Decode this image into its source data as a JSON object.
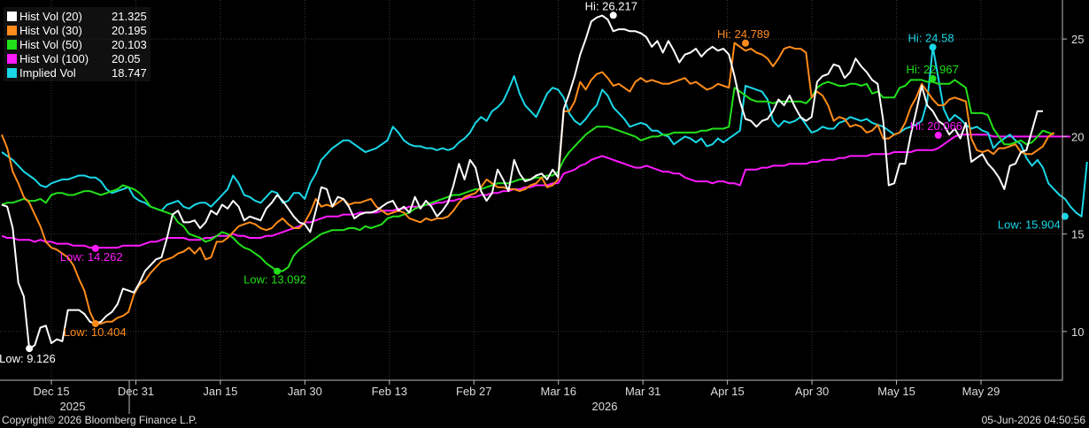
{
  "legend": [
    {
      "name": "Hist Vol (20)",
      "value": "21.325",
      "color": "#ffffff"
    },
    {
      "name": "Hist Vol (30)",
      "value": "20.195",
      "color": "#ff8c1a"
    },
    {
      "name": "Hist Vol (50)",
      "value": "20.103",
      "color": "#22e01a"
    },
    {
      "name": "Hist Vol (100)",
      "value": "20.05",
      "color": "#ff1aff"
    },
    {
      "name": "Implied Vol",
      "value": "18.747",
      "color": "#1ad8e8"
    }
  ],
  "footer": {
    "copyright": "Copyright© 2026 Bloomberg Finance L.P.",
    "timestamp": "05-Jun-2026 04:50:56"
  },
  "chart_data": {
    "type": "line",
    "x_axis": {
      "ticks": [
        "Dec 15",
        "Dec 31",
        "Jan 15",
        "Jan 30",
        "Feb 13",
        "Feb 27",
        "Mar 16",
        "Mar 31",
        "Apr 15",
        "Apr 30",
        "May 15",
        "May 29"
      ],
      "years": [
        "2025",
        "2026"
      ]
    },
    "y_axis": {
      "ylim": [
        7.5,
        27
      ],
      "ticks": [
        "10",
        "15",
        "20",
        "25"
      ],
      "position": "right"
    },
    "grid": true,
    "legend_placement": "top-left",
    "series": [
      {
        "name": "Hist Vol (20)",
        "color": "#ffffff",
        "values": [
          16.5,
          16.4,
          15.3,
          12.5,
          11.8,
          9.1,
          9.3,
          10.2,
          10.3,
          9.4,
          9.6,
          9.5,
          11.1,
          11.1,
          11.1,
          10.9,
          10.5,
          10.4,
          10.5,
          10.8,
          11.0,
          11.4,
          12.2,
          12.1,
          12.0,
          12.5,
          13.1,
          13.4,
          13.7,
          13.8,
          14.8,
          16.0,
          16.2,
          15.6,
          15.6,
          15.7,
          15.3,
          15.6,
          16.2,
          16.0,
          16.5,
          16.3,
          16.7,
          16.4,
          15.7,
          15.9,
          15.8,
          15.7,
          16.3,
          16.6,
          17.0,
          16.7,
          16.3,
          15.9,
          15.6,
          15.5,
          15.1,
          16.2,
          17.4,
          17.3,
          16.4,
          16.9,
          16.8,
          16.4,
          15.8,
          16.0,
          16.1,
          16.1,
          16.2,
          16.4,
          16.6,
          16.7,
          16.2,
          16.4,
          16.1,
          16.9,
          16.3,
          16.7,
          16.4,
          15.9,
          16.2,
          16.6,
          17.5,
          18.6,
          17.8,
          18.8,
          18.4,
          17.2,
          16.7,
          17.1,
          18.3,
          17.8,
          17.2,
          18.8,
          18.1,
          17.7,
          17.8,
          18.0,
          18.1,
          17.8,
          18.3,
          17.9,
          21.4,
          22.2,
          23.1,
          24.2,
          25.0,
          25.9,
          26.1,
          26.2,
          26.0,
          25.4,
          25.5,
          25.5,
          25.4,
          25.4,
          25.3,
          25.1,
          24.6,
          24.9,
          24.3,
          24.9,
          24.4,
          23.8,
          24.2,
          24.3,
          24.5,
          24.1,
          24.4,
          24.6,
          24.4,
          24.5,
          24.2,
          23.1,
          21.8,
          20.9,
          20.8,
          20.5,
          20.8,
          20.9,
          21.3,
          21.9,
          21.6,
          22.1,
          21.5,
          21.0,
          20.8,
          21.0,
          22.8,
          23.1,
          23.2,
          23.7,
          23.6,
          23.0,
          23.3,
          24.0,
          23.6,
          23.3,
          22.9,
          22.7,
          20.8,
          17.5,
          17.6,
          18.6,
          18.6,
          20.1,
          21.3,
          22.6,
          21.6,
          21.3,
          20.8,
          20.6,
          20.1,
          20.4,
          19.9,
          20.7,
          18.7,
          18.9,
          19.1,
          18.6,
          18.3,
          17.9,
          17.3,
          18.5,
          18.6,
          19.2,
          19.3,
          20.3,
          21.3,
          21.3
        ]
      },
      {
        "name": "Hist Vol (30)",
        "color": "#ff8c1a",
        "values": [
          20.1,
          19.4,
          18.2,
          17.6,
          16.9,
          16.6,
          16.0,
          15.4,
          14.6,
          14.3,
          14.2,
          14.0,
          13.8,
          13.4,
          12.7,
          12.1,
          11.0,
          10.4,
          10.4,
          10.5,
          10.5,
          10.7,
          10.8,
          11.0,
          11.9,
          12.4,
          12.6,
          13.0,
          13.3,
          13.6,
          13.7,
          13.8,
          14.0,
          14.1,
          14.3,
          14.0,
          14.3,
          13.7,
          13.8,
          14.6,
          14.6,
          14.8,
          15.1,
          15.4,
          15.5,
          15.6,
          15.5,
          15.3,
          15.2,
          15.3,
          15.6,
          15.8,
          15.5,
          15.3,
          15.3,
          15.6,
          16.1,
          16.8,
          16.4,
          16.5,
          16.4,
          16.6,
          16.8,
          16.5,
          16.6,
          16.6,
          16.7,
          16.8,
          16.4,
          16.2,
          16.0,
          16.1,
          16.2,
          16.1,
          15.8,
          15.7,
          15.6,
          15.8,
          15.7,
          15.8,
          15.8,
          15.9,
          16.2,
          16.6,
          16.9,
          17.0,
          17.1,
          17.4,
          17.8,
          17.6,
          17.4,
          17.4,
          17.3,
          17.3,
          17.2,
          17.3,
          17.5,
          17.6,
          17.9,
          17.4,
          17.5,
          17.8,
          21.3,
          21.3,
          21.8,
          22.8,
          22.4,
          22.9,
          23.2,
          23.3,
          23.0,
          22.6,
          22.7,
          22.5,
          22.3,
          22.8,
          23.0,
          22.8,
          22.9,
          22.8,
          22.7,
          22.7,
          22.8,
          22.9,
          23.0,
          22.7,
          22.8,
          22.6,
          22.4,
          22.5,
          22.7,
          22.6,
          22.5,
          24.8,
          24.6,
          24.4,
          24.5,
          24.3,
          24.2,
          24.0,
          23.6,
          24.0,
          24.5,
          24.6,
          24.5,
          24.5,
          24.3,
          22.0,
          22.3,
          22.1,
          21.6,
          20.8,
          21.0,
          20.9,
          20.5,
          20.6,
          20.5,
          20.2,
          20.3,
          20.6,
          19.9,
          19.9,
          20.1,
          20.2,
          20.7,
          21.5,
          22.0,
          22.7,
          22.3,
          21.9,
          21.6,
          21.6,
          21.9,
          22.0,
          21.9,
          21.8,
          19.9,
          19.3,
          19.2,
          19.3,
          19.1,
          19.4,
          19.4,
          19.5,
          19.6,
          19.2,
          19.1,
          19.1,
          19.3,
          19.5,
          20.0,
          20.2
        ]
      },
      {
        "name": "Hist Vol (50)",
        "color": "#22e01a",
        "values": [
          16.5,
          16.6,
          16.6,
          16.7,
          16.8,
          16.7,
          16.7,
          16.8,
          16.6,
          17.0,
          17.1,
          17.1,
          17.0,
          17.0,
          17.1,
          17.2,
          17.2,
          17.1,
          17.0,
          17.1,
          17.2,
          17.3,
          17.5,
          17.4,
          17.3,
          17.1,
          16.8,
          16.4,
          16.3,
          16.2,
          16.1,
          16.0,
          15.6,
          15.4,
          15.0,
          14.9,
          14.8,
          14.6,
          14.7,
          14.9,
          15.1,
          15.0,
          14.8,
          14.5,
          14.3,
          14.2,
          14.0,
          13.8,
          13.5,
          13.3,
          13.1,
          13.1,
          13.3,
          13.9,
          14.2,
          14.4,
          14.6,
          14.8,
          15.0,
          15.1,
          15.2,
          15.2,
          15.2,
          15.3,
          15.3,
          15.2,
          15.4,
          15.3,
          15.4,
          15.5,
          15.8,
          15.9,
          15.9,
          16.0,
          16.1,
          16.3,
          16.4,
          16.5,
          16.6,
          16.7,
          16.8,
          16.9,
          17.0,
          17.0,
          17.1,
          17.2,
          17.3,
          17.3,
          17.4,
          17.5,
          17.6,
          17.6,
          17.6,
          17.7,
          17.8,
          17.8,
          17.8,
          17.9,
          17.9,
          18.0,
          18.0,
          18.2,
          18.8,
          19.2,
          19.5,
          19.8,
          20.1,
          20.3,
          20.5,
          20.5,
          20.5,
          20.4,
          20.3,
          20.2,
          20.1,
          20.0,
          19.8,
          19.9,
          20.0,
          20.0,
          20.1,
          20.1,
          20.2,
          20.2,
          20.2,
          20.2,
          20.2,
          20.3,
          20.3,
          20.4,
          20.4,
          20.4,
          20.5,
          22.5,
          22.3,
          22.1,
          21.9,
          21.8,
          21.8,
          21.8,
          21.7,
          21.8,
          21.8,
          21.8,
          21.8,
          21.8,
          21.7,
          22.0,
          22.5,
          22.7,
          22.8,
          22.7,
          22.6,
          22.6,
          22.7,
          22.7,
          22.6,
          22.7,
          22.2,
          22.3,
          22.0,
          22.0,
          22.0,
          22.5,
          22.6,
          22.9,
          22.9,
          22.9,
          22.8,
          22.8,
          22.7,
          22.7,
          22.7,
          22.9,
          22.7,
          22.5,
          21.2,
          21.2,
          21.2,
          21.1,
          20.4,
          20.0,
          19.6,
          19.6,
          19.7,
          19.8,
          19.6,
          19.7,
          20.0,
          20.3,
          20.2,
          20.1
        ]
      },
      {
        "name": "Hist Vol (100)",
        "color": "#ff1aff",
        "values": [
          14.9,
          14.8,
          14.8,
          14.7,
          14.7,
          14.7,
          14.6,
          14.7,
          14.6,
          14.6,
          14.5,
          14.5,
          14.5,
          14.4,
          14.4,
          14.4,
          14.3,
          14.3,
          14.3,
          14.3,
          14.3,
          14.3,
          14.4,
          14.4,
          14.4,
          14.4,
          14.5,
          14.6,
          14.6,
          14.7,
          14.8,
          14.8,
          14.8,
          14.8,
          14.7,
          14.7,
          14.7,
          14.8,
          14.8,
          14.9,
          14.9,
          14.9,
          15.0,
          14.9,
          14.9,
          14.8,
          14.8,
          14.8,
          14.9,
          14.9,
          15.0,
          15.1,
          15.2,
          15.3,
          15.4,
          15.6,
          15.6,
          15.7,
          15.8,
          15.9,
          15.9,
          15.9,
          16.0,
          16.0,
          16.0,
          16.1,
          16.1,
          16.1,
          16.1,
          16.2,
          16.2,
          16.2,
          16.3,
          16.3,
          16.4,
          16.4,
          16.4,
          16.5,
          16.5,
          16.6,
          16.6,
          16.7,
          16.7,
          16.8,
          16.8,
          16.9,
          16.9,
          17.0,
          17.0,
          17.1,
          17.1,
          17.2,
          17.2,
          17.3,
          17.3,
          17.4,
          17.4,
          17.5,
          17.5,
          17.5,
          17.6,
          17.6,
          18.1,
          18.2,
          18.3,
          18.5,
          18.6,
          18.8,
          18.9,
          19.0,
          18.9,
          18.8,
          18.7,
          18.6,
          18.5,
          18.4,
          18.4,
          18.5,
          18.4,
          18.3,
          18.2,
          18.2,
          18.1,
          18.1,
          17.9,
          17.8,
          17.7,
          17.7,
          17.7,
          17.6,
          17.7,
          17.7,
          17.6,
          17.6,
          17.5,
          18.3,
          18.3,
          18.3,
          18.4,
          18.4,
          18.5,
          18.5,
          18.5,
          18.6,
          18.6,
          18.6,
          18.6,
          18.7,
          18.7,
          18.8,
          18.8,
          18.8,
          18.9,
          18.9,
          19.0,
          19.0,
          19.0,
          19.0,
          19.1,
          19.1,
          19.1,
          19.1,
          19.2,
          19.2,
          19.2,
          19.2,
          19.3,
          19.3,
          19.3,
          19.3,
          19.4,
          19.6,
          19.8,
          20.0,
          20.1,
          20.1,
          20.1,
          20.1,
          20.1,
          20.1,
          20.0,
          20.0,
          20.0,
          20.0,
          20.0,
          20.0,
          20.0,
          20.0,
          20.0,
          20.0,
          20.0,
          20.0,
          20.0,
          20.0,
          20.0
        ]
      },
      {
        "name": "Implied Vol",
        "color": "#1ad8e8",
        "values": [
          19.2,
          19.0,
          18.8,
          18.5,
          18.2,
          18.0,
          17.8,
          17.5,
          17.4,
          17.6,
          17.7,
          17.8,
          17.8,
          17.9,
          18.0,
          18.0,
          17.9,
          17.9,
          17.7,
          17.3,
          17.1,
          17.2,
          17.3,
          17.4,
          16.9,
          16.7,
          16.6,
          16.4,
          16.3,
          16.2,
          16.5,
          16.6,
          16.7,
          16.4,
          16.3,
          16.5,
          16.6,
          16.6,
          16.4,
          16.7,
          17.0,
          17.3,
          18.0,
          17.6,
          17.0,
          16.9,
          16.7,
          16.6,
          16.9,
          17.2,
          17.1,
          16.6,
          16.7,
          17.1,
          17.1,
          16.8,
          17.6,
          18.1,
          18.8,
          19.1,
          19.4,
          19.6,
          19.8,
          19.8,
          19.6,
          19.4,
          19.2,
          19.3,
          19.4,
          19.6,
          19.8,
          20.5,
          20.2,
          19.8,
          19.6,
          19.5,
          19.5,
          19.4,
          19.4,
          19.3,
          19.4,
          19.3,
          19.4,
          19.7,
          19.9,
          20.2,
          20.7,
          21.0,
          20.8,
          21.3,
          21.5,
          21.8,
          22.4,
          23.1,
          22.2,
          21.6,
          21.3,
          21.0,
          21.6,
          22.2,
          22.5,
          22.4,
          22.0,
          21.2,
          20.8,
          20.6,
          20.9,
          21.3,
          21.6,
          22.4,
          22.1,
          21.5,
          21.2,
          20.9,
          20.5,
          20.6,
          20.7,
          20.6,
          20.3,
          20.3,
          20.1,
          20.0,
          19.6,
          19.8,
          20.0,
          19.9,
          19.7,
          19.9,
          19.5,
          19.6,
          19.9,
          19.7,
          19.9,
          20.1,
          20.3,
          22.6,
          22.5,
          22.4,
          22.3,
          21.9,
          20.8,
          20.5,
          20.8,
          20.7,
          20.8,
          21.0,
          20.6,
          20.2,
          20.3,
          20.5,
          20.4,
          20.4,
          20.7,
          20.8,
          21.0,
          20.9,
          20.8,
          20.9,
          20.7,
          20.6,
          20.5,
          20.3,
          20.1,
          20.2,
          20.4,
          20.5,
          20.6,
          20.8,
          21.8,
          24.6,
          23.0,
          21.4,
          20.8,
          21.1,
          20.9,
          20.6,
          20.4,
          20.5,
          20.3,
          20.2,
          19.4,
          19.7,
          19.9,
          20.1,
          19.8,
          19.6,
          18.9,
          18.5,
          18.8,
          18.4,
          17.6,
          17.3,
          17.0,
          16.8,
          16.4,
          16.1,
          15.9,
          18.7
        ]
      }
    ],
    "annotations": [
      {
        "label": "Low: 9.126",
        "series": 0,
        "index": 5,
        "value": 9.126,
        "color": "#ffffff"
      },
      {
        "label": "Low: 10.404",
        "series": 1,
        "index": 17,
        "value": 10.404,
        "color": "#ff8c1a"
      },
      {
        "label": "Low: 14.262",
        "series": 3,
        "index": 17,
        "value": 14.262,
        "color": "#ff1aff"
      },
      {
        "label": "Low: 13.092",
        "series": 2,
        "index": 50,
        "value": 13.092,
        "color": "#22e01a"
      },
      {
        "label": "Hi: 26.217",
        "series": 0,
        "index": 111,
        "value": 26.217,
        "color": "#ffffff"
      },
      {
        "label": "Hi: 24.789",
        "series": 1,
        "index": 135,
        "value": 24.789,
        "color": "#ff8c1a"
      },
      {
        "label": "Hi: 24.58",
        "series": 4,
        "index": 169,
        "value": 24.58,
        "color": "#1ad8e8"
      },
      {
        "label": "Hi: 22.967",
        "series": 2,
        "index": 169,
        "value": 22.967,
        "color": "#22e01a"
      },
      {
        "label": "Hi: 20.066",
        "series": 3,
        "index": 170,
        "value": 20.066,
        "color": "#ff1aff"
      },
      {
        "label": "Low: 15.904",
        "series": 4,
        "index": 193,
        "value": 15.904,
        "color": "#1ad8e8"
      }
    ]
  }
}
